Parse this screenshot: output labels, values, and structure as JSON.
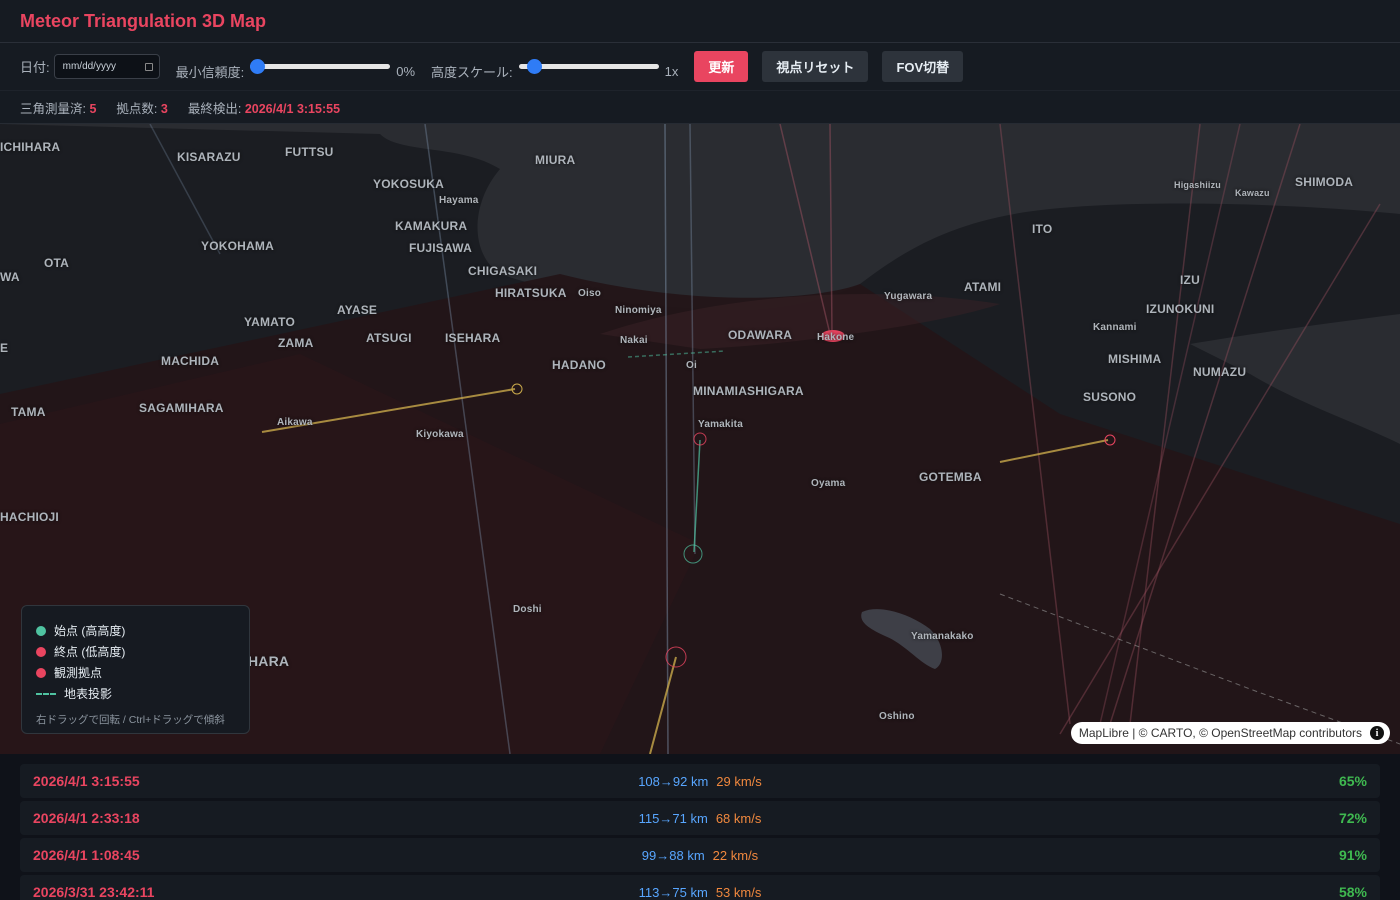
{
  "app": {
    "title": "Meteor Triangulation 3D Map"
  },
  "controls": {
    "date_label": "日付:",
    "date_placeholder": "mm/dd/yyyy",
    "min_conf_label": "最小信頼度:",
    "min_conf_value": "0%",
    "min_conf_level": 0,
    "alt_scale_label": "高度スケール:",
    "alt_scale_value": "1x",
    "alt_scale_level": 0,
    "update_button": "更新",
    "reset_view_button": "視点リセット",
    "fov_button": "FOV切替"
  },
  "stats": {
    "triangulated_label": "三角測量済:",
    "triangulated_value": "5",
    "stations_label": "拠点数:",
    "stations_value": "3",
    "last_detect_label": "最終検出:",
    "last_detect_value": "2026/4/1 3:15:55"
  },
  "map": {
    "places": [
      "ICHIHARA",
      "KISARAZU",
      "FUTTSU",
      "MIURA",
      "YOKOSUKA",
      "Hayama",
      "KAMAKURA",
      "FUJISAWA",
      "YOKOHAMA",
      "OTA",
      "WA",
      "CHIGASAKI",
      "HIRATSUKA",
      "Oiso",
      "AYASE",
      "YAMATO",
      "ZAMA",
      "ATSUGI",
      "ISEHARA",
      "MACHIDA",
      "TAMA",
      "SAGAMIHARA",
      "Aikawa",
      "Kiyokawa",
      "HACHIOJI",
      "HADANO",
      "Ninomiya",
      "Nakai",
      "Oi",
      "ODAWARA",
      "Hakone",
      "MINAMIASHIGARA",
      "Yamakita",
      "Oyama",
      "GOTEMBA",
      "Yugawara",
      "ATAMI",
      "ITO",
      "Higashiizu",
      "Kawazu",
      "SHIMODA",
      "IZU",
      "IZUNOKUNI",
      "Kannami",
      "MISHIMA",
      "NUMAZU",
      "SUSONO",
      "Doshi",
      "Yamanakako",
      "Oshino",
      "HARA",
      "E"
    ],
    "attribution": "MapLibre | © CARTO, © OpenStreetMap contributors"
  },
  "legend": {
    "start": "始点 (高高度)",
    "end": "終点 (低高度)",
    "station": "観測拠点",
    "projection": "地表投影",
    "hint": "右ドラッグで回転 / Ctrl+ドラッグで傾斜"
  },
  "colors": {
    "accent": "#e94560",
    "start": "#4fc3a1",
    "end": "#e94560",
    "altitude": "#58a6ff",
    "speed": "#f0883e",
    "confidence": "#3fb950"
  },
  "detections": [
    {
      "time": "2026/4/1 3:15:55",
      "altitude": "108→92 km",
      "speed": "29 km/s",
      "confidence": "65%"
    },
    {
      "time": "2026/4/1 2:33:18",
      "altitude": "115→71 km",
      "speed": "68 km/s",
      "confidence": "72%"
    },
    {
      "time": "2026/4/1 1:08:45",
      "altitude": "99→88 km",
      "speed": "22 km/s",
      "confidence": "91%"
    },
    {
      "time": "2026/3/31 23:42:11",
      "altitude": "113→75 km",
      "speed": "53 km/s",
      "confidence": "58%"
    }
  ]
}
